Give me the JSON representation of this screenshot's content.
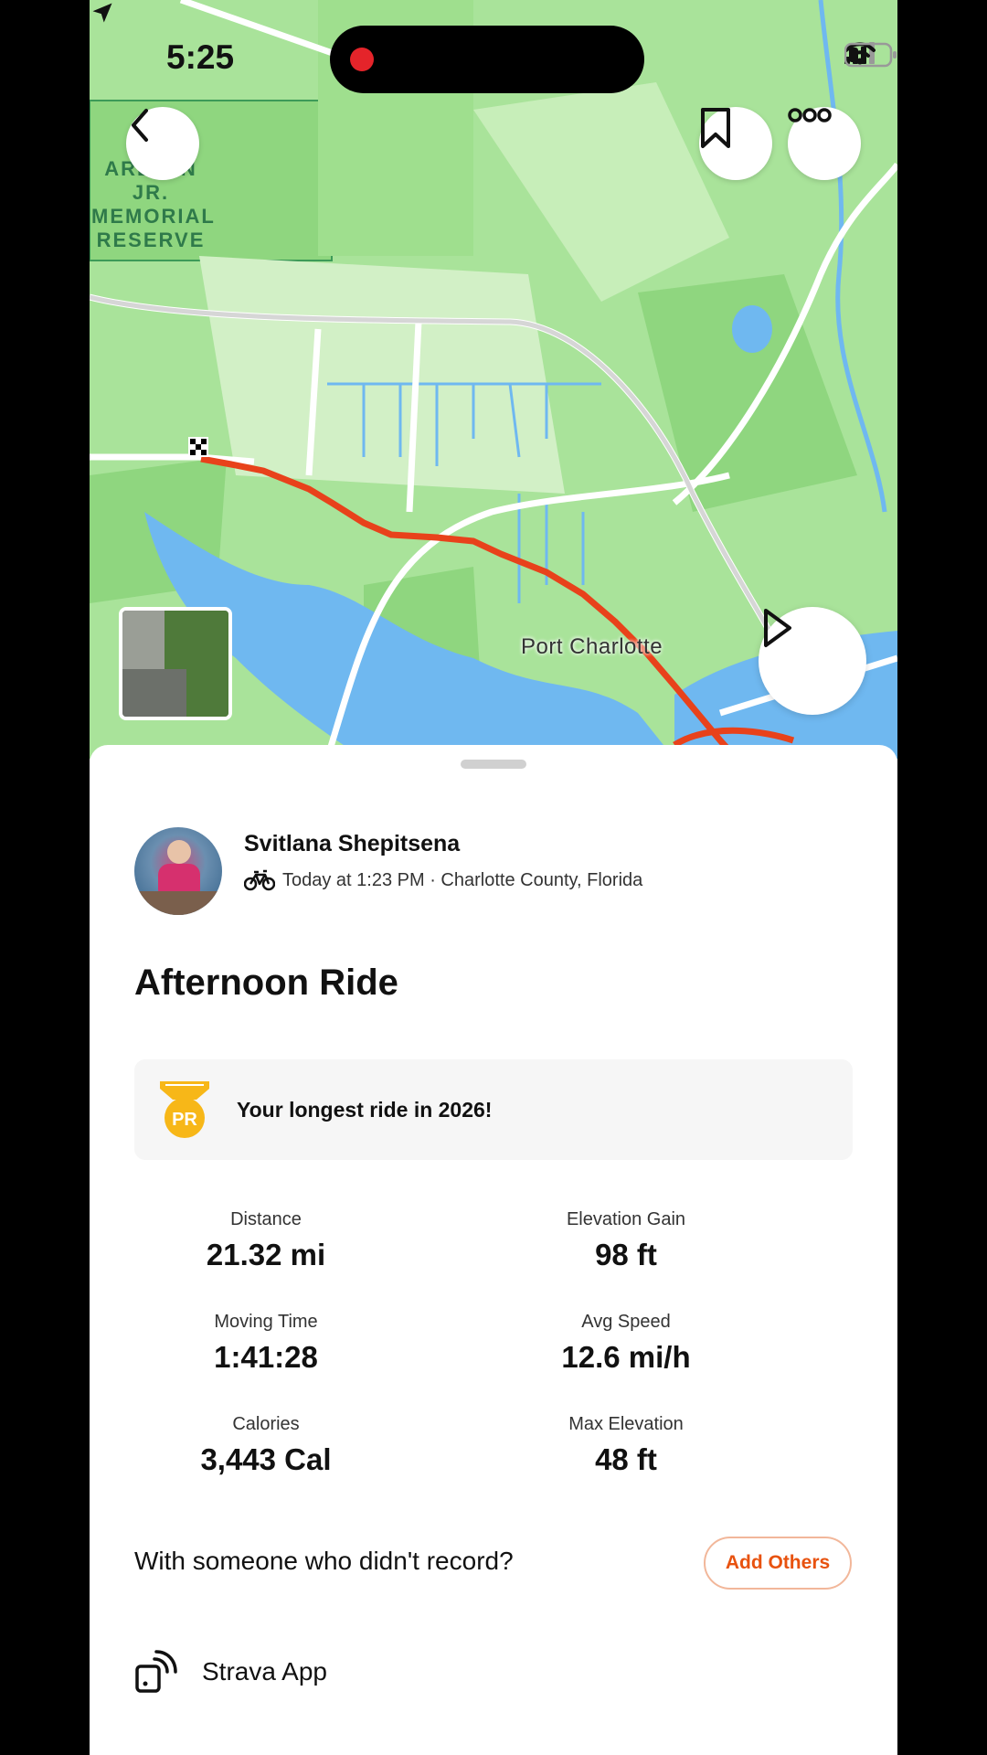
{
  "status_bar": {
    "time": "5:25"
  },
  "map": {
    "place_label": "Port Charlotte",
    "preserve_label": "T. M\nARLTON JR.\nMEMORIAL\nRESERVE",
    "colors": {
      "route": "#e8421b",
      "land": "#a9e39a",
      "water": "#6fb8f0",
      "road": "#ffffff"
    }
  },
  "activity": {
    "athlete_name": "Svitlana Shepitsena",
    "meta": "Today at 1:23 PM · Charlotte County, Florida",
    "title": "Afternoon Ride",
    "achievement": "Your longest ride in 2026!",
    "achievement_badge": "PR"
  },
  "stats": [
    {
      "label": "Distance",
      "value": "21.32 mi"
    },
    {
      "label": "Elevation Gain",
      "value": "98 ft"
    },
    {
      "label": "Moving Time",
      "value": "1:41:28"
    },
    {
      "label": "Avg Speed",
      "value": "12.6 mi/h"
    },
    {
      "label": "Calories",
      "value": "3,443 Cal"
    },
    {
      "label": "Max Elevation",
      "value": "48 ft"
    }
  ],
  "with_others": {
    "prompt": "With someone who didn't record?",
    "button": "Add Others"
  },
  "device": {
    "label": "Strava App"
  },
  "icons": [
    "location-arrow-icon",
    "signal-icon",
    "wifi-icon",
    "battery-icon",
    "back-icon",
    "bookmark-icon",
    "more-icon",
    "play-icon",
    "bike-icon",
    "pr-badge-icon",
    "device-icon"
  ]
}
